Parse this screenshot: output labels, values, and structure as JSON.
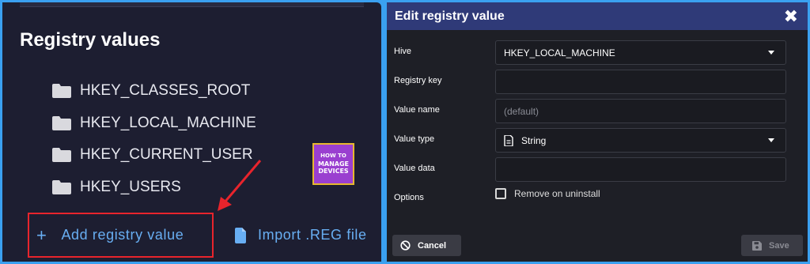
{
  "left_panel": {
    "title": "Registry values",
    "tree": [
      {
        "label": "HKEY_CLASSES_ROOT",
        "icon": "folder-icon"
      },
      {
        "label": "HKEY_LOCAL_MACHINE",
        "icon": "folder-icon"
      },
      {
        "label": "HKEY_CURRENT_USER",
        "icon": "folder-icon"
      },
      {
        "label": "HKEY_USERS",
        "icon": "folder-icon"
      }
    ],
    "add_button": {
      "icon": "+",
      "label": "Add registry value"
    },
    "import_button": {
      "label": "Import .REG file",
      "icon": "file-icon"
    },
    "logo": {
      "line1": "HOW TO",
      "line2": "MANAGE",
      "line3": "DEVICES"
    }
  },
  "dialog": {
    "title": "Edit registry value",
    "close_icon": "✖",
    "fields": {
      "hive": {
        "label": "Hive",
        "value": "HKEY_LOCAL_MACHINE"
      },
      "registry_key": {
        "label": "Registry key",
        "value": ""
      },
      "value_name": {
        "label": "Value name",
        "placeholder": "(default)"
      },
      "value_type": {
        "label": "Value type",
        "value": "String"
      },
      "value_data": {
        "label": "Value data",
        "value": ""
      },
      "options": {
        "label": "Options",
        "checkbox_label": "Remove on uninstall",
        "checked": false
      }
    },
    "cancel_label": "Cancel",
    "save_label": "Save"
  },
  "colors": {
    "frame": "#3aa0f0",
    "panel_bg": "#1d1e31",
    "dialog_header": "#2f3a78",
    "link": "#68aef2",
    "highlight": "#e8242c"
  }
}
